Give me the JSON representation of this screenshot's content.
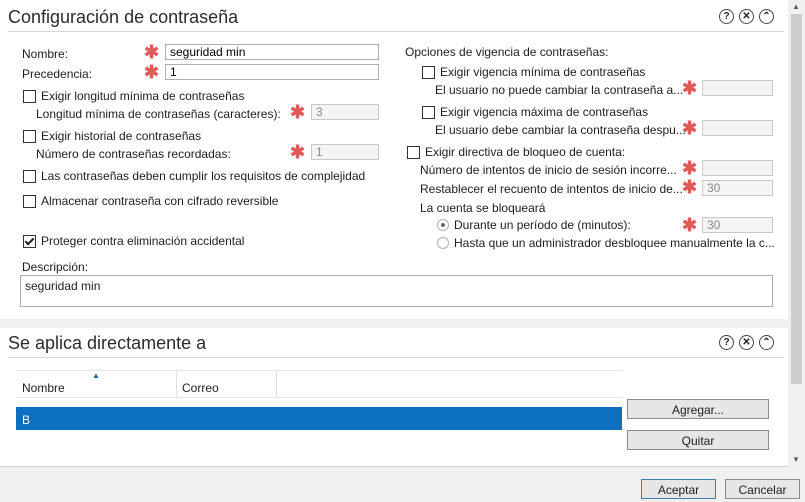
{
  "section1": {
    "title": "Configuración de contraseña",
    "nombre_label": "Nombre:",
    "nombre_value": "seguridad min",
    "precedencia_label": "Precedencia:",
    "precedencia_value": "1",
    "min_length_check": "Exigir longitud mínima de contraseñas",
    "min_length_label": "Longitud mínima de contraseñas (caracteres):",
    "min_length_value": "3",
    "history_check": "Exigir historial de contraseñas",
    "history_label": "Número de contraseñas recordadas:",
    "history_value": "1",
    "complexity_check": "Las contraseñas deben cumplir los requisitos de complejidad",
    "reversible_check": "Almacenar contraseña con cifrado reversible",
    "protect_check": "Proteger contra eliminación accidental",
    "descripcion_label": "Descripción:",
    "descripcion_value": "seguridad min",
    "vigencia_title": "Opciones de vigencia de contraseñas:",
    "vig_min_check": "Exigir vigencia mínima de contraseñas",
    "vig_min_label": "El usuario no puede cambiar la contraseña a...",
    "vig_max_check": "Exigir vigencia máxima de contraseñas",
    "vig_max_label": "El usuario debe cambiar la contraseña despu...",
    "lockout_check": "Exigir directiva de bloqueo de cuenta:",
    "lock_attempts_label": "Número de intentos de inicio de sesión incorre...",
    "lock_reset_label": "Restablecer el recuento de intentos de inicio de...",
    "lock_reset_value": "30",
    "lock_account_label": "La cuenta se bloqueará",
    "lock_period_label": "Durante un período de (minutos):",
    "lock_period_value": "30",
    "lock_admin_label": "Hasta que un administrador desbloquee manualmente la c..."
  },
  "section2": {
    "title": "Se aplica directamente a",
    "col_nombre": "Nombre",
    "col_correo": "Correo",
    "rows": [
      {
        "nombre": "B",
        "correo": ""
      }
    ],
    "add_button": "Agregar...",
    "remove_button": "Quitar"
  },
  "header_icons": {
    "help": "?",
    "close": "✕",
    "collapse": "⌃"
  },
  "footer": {
    "ok_button": "Aceptar",
    "cancel_button": "Cancelar"
  },
  "colors": {
    "selection": "#0c6fc0",
    "required": "#e05a5a"
  }
}
